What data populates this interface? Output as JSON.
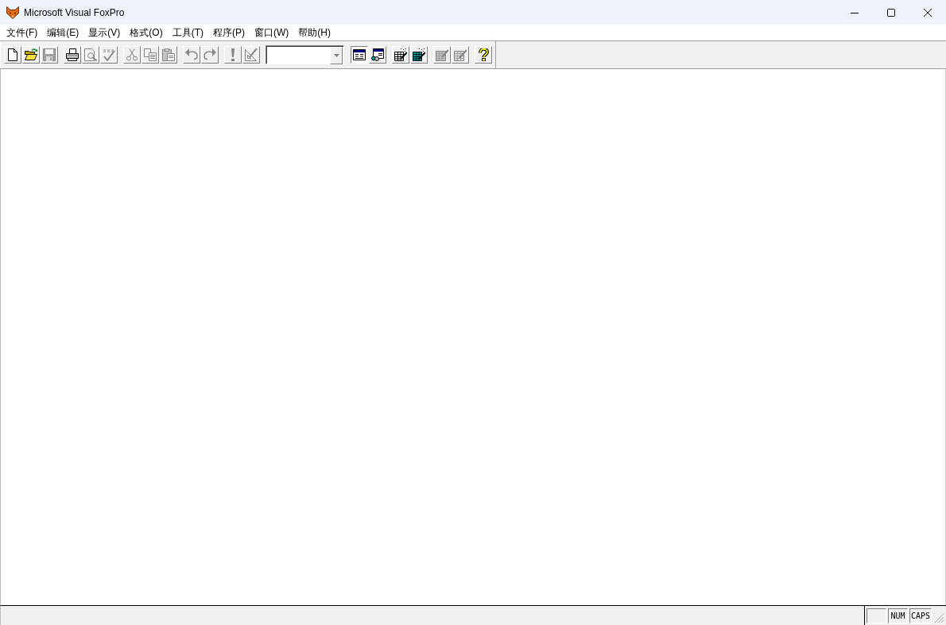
{
  "window": {
    "title": "Microsoft Visual FoxPro"
  },
  "menu": [
    "文件(F)",
    "编辑(E)",
    "显示(V)",
    "格式(O)",
    "工具(T)",
    "程序(P)",
    "窗口(W)",
    "帮助(H)"
  ],
  "toolbar": {
    "groups": [
      {
        "items": [
          {
            "kind": "button",
            "disabled": false,
            "pressed": false
          },
          {
            "kind": "button",
            "disabled": false,
            "pressed": false
          },
          {
            "kind": "button",
            "disabled": true,
            "pressed": false
          }
        ]
      },
      {
        "items": [
          {
            "kind": "button",
            "disabled": false,
            "pressed": false
          },
          {
            "kind": "button",
            "disabled": true,
            "pressed": false
          },
          {
            "kind": "button",
            "disabled": true,
            "pressed": false
          }
        ]
      },
      {
        "items": [
          {
            "kind": "button",
            "disabled": true,
            "pressed": false
          },
          {
            "kind": "button",
            "disabled": true,
            "pressed": false
          },
          {
            "kind": "button",
            "disabled": true,
            "pressed": false
          }
        ]
      },
      {
        "items": [
          {
            "kind": "button",
            "disabled": true,
            "pressed": false
          },
          {
            "kind": "button",
            "disabled": true,
            "pressed": false
          }
        ]
      },
      {
        "items": [
          {
            "kind": "button",
            "disabled": true,
            "pressed": false
          },
          {
            "kind": "button",
            "disabled": true,
            "pressed": false
          }
        ]
      },
      {
        "items": [
          {
            "kind": "combo",
            "disabled": false
          }
        ]
      },
      {
        "items": [
          {
            "kind": "button",
            "disabled": false,
            "pressed": true
          },
          {
            "kind": "button",
            "disabled": false,
            "pressed": false
          }
        ]
      },
      {
        "items": [
          {
            "kind": "button",
            "disabled": false,
            "pressed": false
          },
          {
            "kind": "button",
            "disabled": false,
            "pressed": false
          }
        ]
      },
      {
        "items": [
          {
            "kind": "button",
            "disabled": true,
            "pressed": false
          },
          {
            "kind": "button",
            "disabled": true,
            "pressed": false
          }
        ]
      },
      {
        "items": [
          {
            "kind": "button",
            "disabled": false,
            "pressed": false
          }
        ]
      }
    ]
  },
  "status_bar": {
    "indicators": [
      "NUM",
      "CAPS"
    ]
  }
}
